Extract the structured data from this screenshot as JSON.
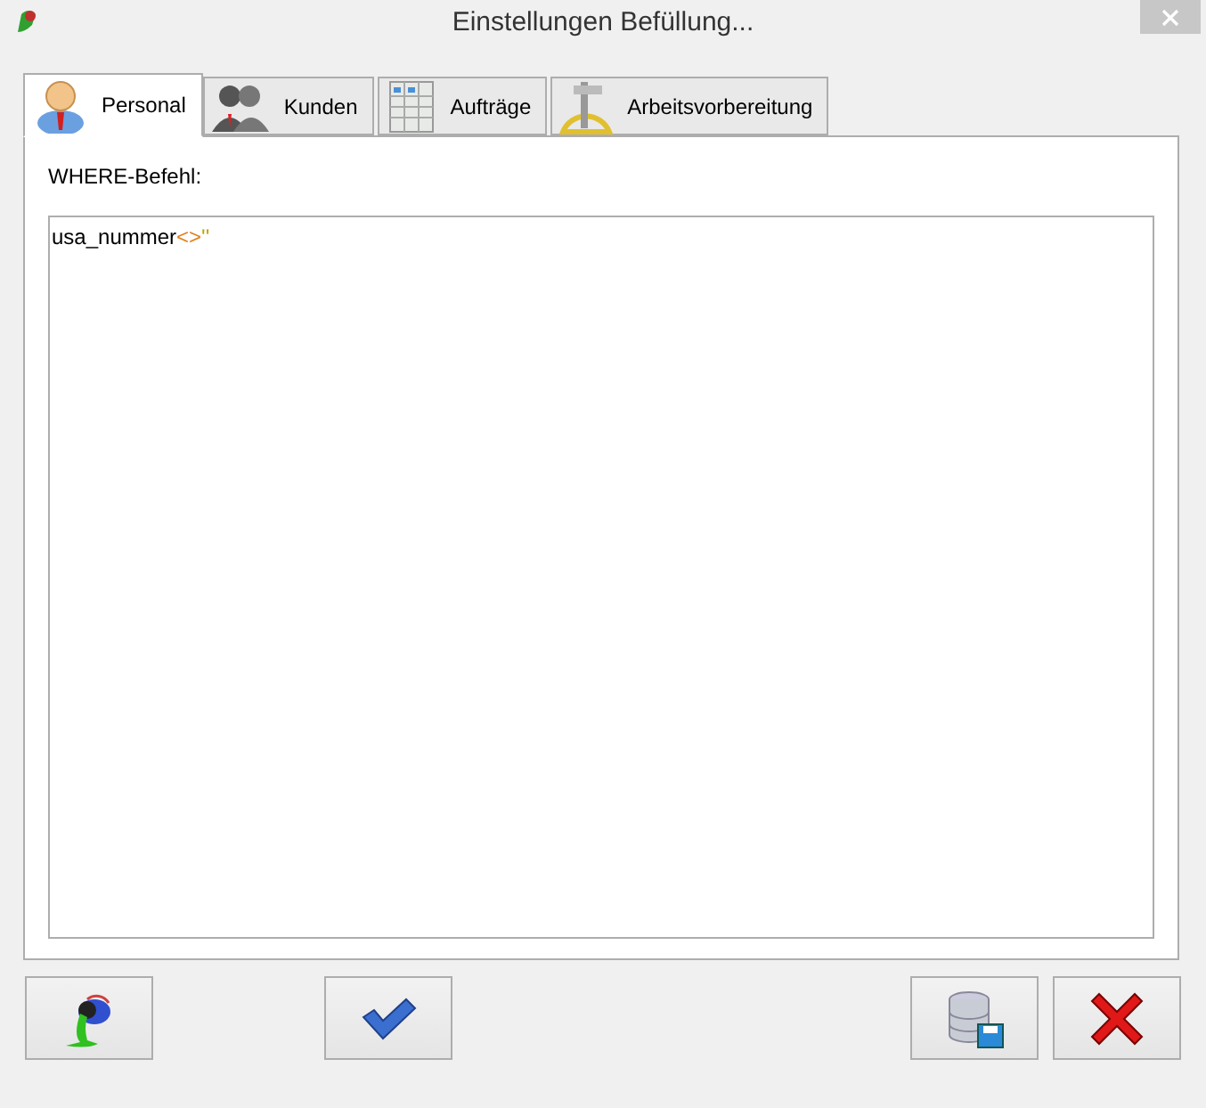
{
  "window": {
    "title": "Einstellungen Befüllung..."
  },
  "tabs": [
    {
      "label": "Personal",
      "kind": "person",
      "selected": true
    },
    {
      "label": "Kunden",
      "kind": "people",
      "selected": false
    },
    {
      "label": "Aufträge",
      "kind": "sheet",
      "selected": false
    },
    {
      "label": "Arbeitsvorbereitung",
      "kind": "caliper",
      "selected": false
    }
  ],
  "where_label": "WHERE-Befehl:",
  "editor": {
    "tokens": [
      {
        "kind": "identifier",
        "text": "usa_nummer"
      },
      {
        "kind": "operator",
        "text": "<>"
      },
      {
        "kind": "string",
        "text": "''"
      }
    ]
  },
  "buttons": [
    {
      "kind": "fill"
    },
    {
      "kind": "ok"
    },
    {
      "kind": "save"
    },
    {
      "kind": "cancel"
    }
  ]
}
